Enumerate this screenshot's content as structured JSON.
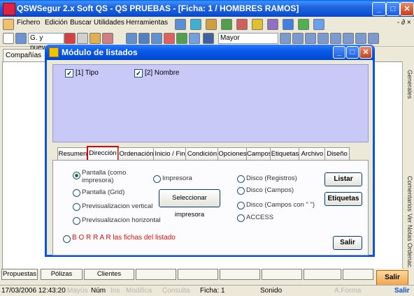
{
  "window": {
    "title": "QSWSegur 2.x  Soft QS - QS PRUEBAS - [Ficha: 1  /  HOMBRES RAMOS]",
    "min": "_",
    "max": "□",
    "close": "✕"
  },
  "menu": [
    "Fichero",
    "Edición",
    "Buscar",
    "Utilidades",
    "Herramientas"
  ],
  "toolbar": {
    "select1": "G. y nueva",
    "select2": "Mayor"
  },
  "left_tab": "Compañías",
  "right_tabs": [
    "Generales",
    "Comentarios",
    "Ver Notas",
    "Ordenac."
  ],
  "background_letter": "N",
  "dialog": {
    "title": "Módulo de listados",
    "fields": [
      {
        "label": "[1] Tipo",
        "checked": "✓"
      },
      {
        "label": "[2] Nombre",
        "checked": "✓"
      }
    ],
    "tabs": [
      "Resumen",
      "Dirección",
      "Ordenación",
      "Inicio / Fin",
      "Condición",
      "Opciones",
      "Campos",
      "Etiquetas",
      "Archivo",
      "Diseño"
    ],
    "active_tab": "Dirección",
    "options": {
      "pantalla_line1": "Pantalla (como",
      "pantalla_line2": "impresora)",
      "impresora": "Impresora",
      "pantalla_grid": "Pantalla (Grid)",
      "prev_vertical": "Previsualizacion vertical",
      "prev_horizontal": "Previsualizacion horizontal",
      "disco_registros": "Disco (Registros)",
      "disco_campos": "Disco (Campos)",
      "disco_campos_con": "Disco (Campos con \" \")",
      "access": "ACCESS"
    },
    "buttons": {
      "seleccionar": "Seleccionar impresora",
      "listar": "Listar",
      "etiquetas": "Etiquetas",
      "salir": "Salir"
    },
    "borrar_bold": "B O R R A R",
    "borrar_rest": "las fichas del listado"
  },
  "bottom_tabs": [
    "Propuestas",
    "Pólizas",
    "Clientes",
    "",
    "",
    "",
    "",
    "",
    "",
    ""
  ],
  "salir_main": "Salir",
  "status": {
    "datetime": "17/03/2006  12:43:20",
    "mayus": "Mayús",
    "num": "Núm",
    "ins": "Ins",
    "modifica": "Modifica",
    "consulta": "Consulta",
    "ficha": "Ficha: 1",
    "sonido": "Sonido",
    "aforma": "A.Forma",
    "salir": "Salir"
  }
}
